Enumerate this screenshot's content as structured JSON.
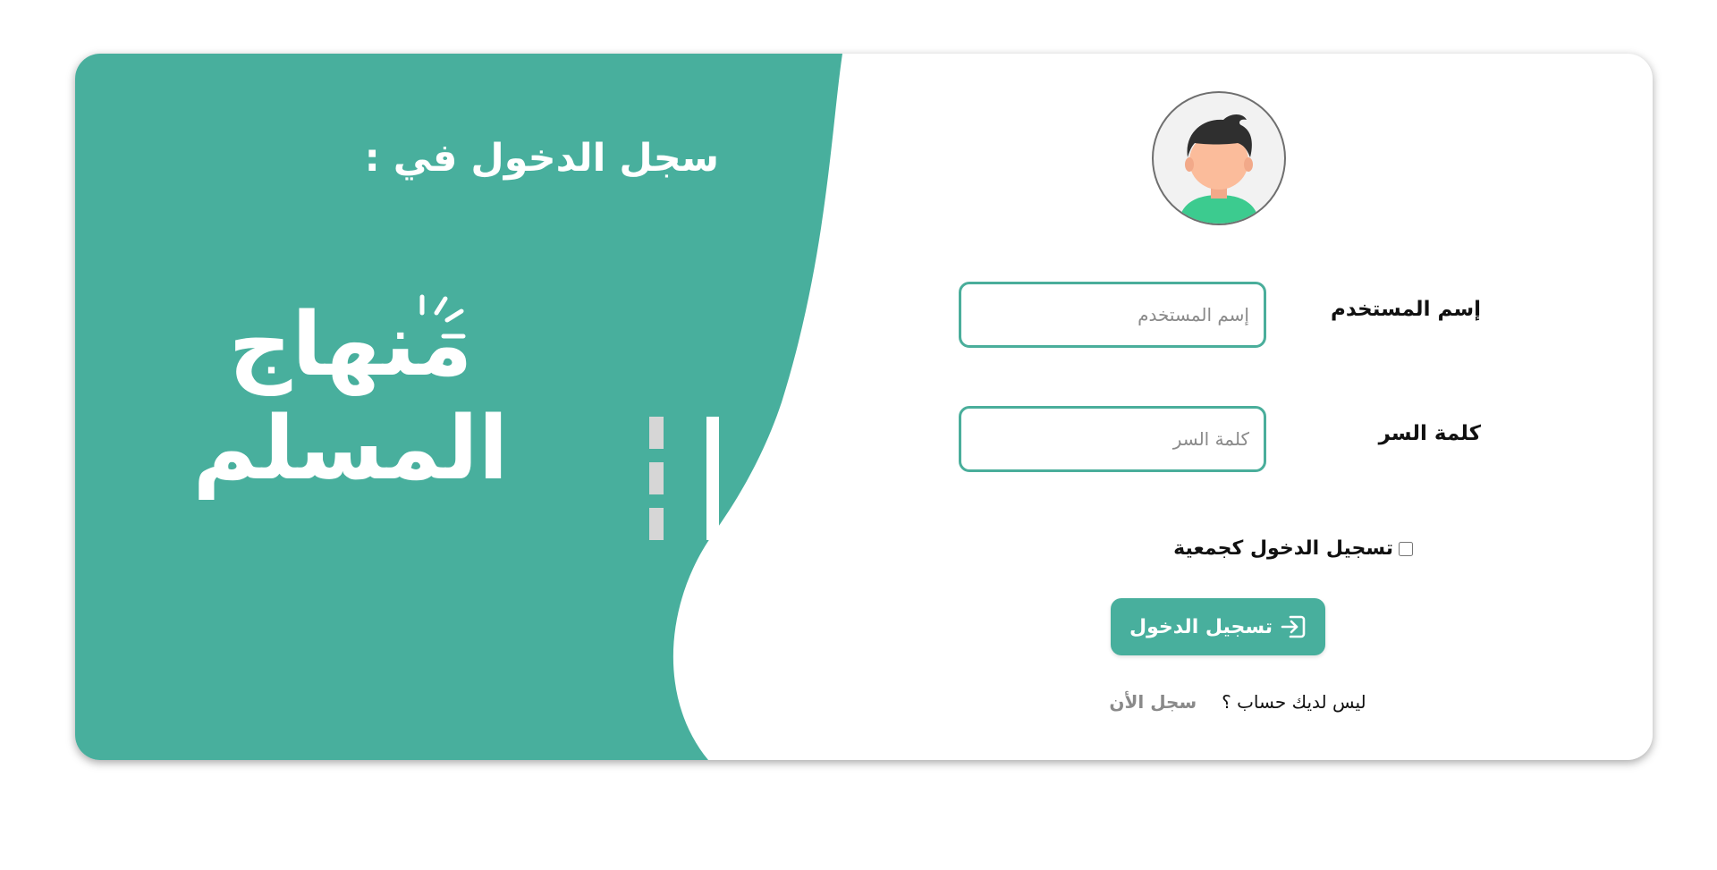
{
  "banner": {
    "title": "سجل الدخول في :",
    "logo_text": "منهاج المسلم"
  },
  "form": {
    "username_label": "إسم المستخدم",
    "username_placeholder": "إسم المستخدم",
    "password_label": "كلمة السر",
    "password_placeholder": "كلمة السر",
    "group_login_label": "تسجيل الدخول كجمعية",
    "group_login_checked": false,
    "login_button": "تسجيل الدخول",
    "no_account_text": "ليس لديك حساب ؟",
    "signup_link": "سجل الأن"
  },
  "icons": {
    "avatar": "user-avatar-icon",
    "login": "login-arrow-icon"
  },
  "colors": {
    "brand_green": "#48af9d",
    "input_border": "#4aae9b",
    "logo_gray": "#d6d6d6",
    "link_gray": "#8a8a8a"
  }
}
